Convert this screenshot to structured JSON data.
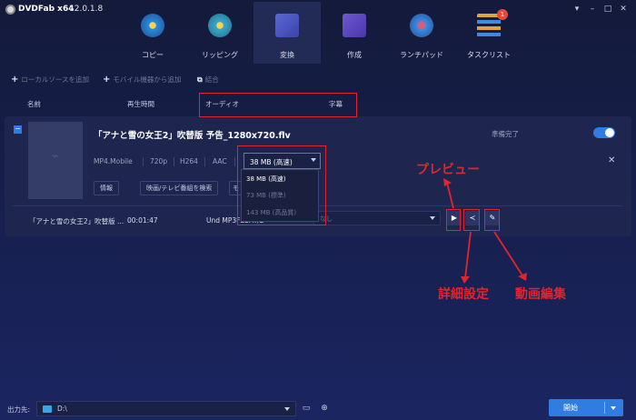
{
  "app": {
    "name": "DVDFab x64",
    "version": "12.0.1.8"
  },
  "tabs": [
    {
      "label": "コピー",
      "icon": "copy-disc-icon",
      "color": "#2a8bd8"
    },
    {
      "label": "リッピング",
      "icon": "ripper-disc-icon",
      "color": "#3aa7c9"
    },
    {
      "label": "変換",
      "icon": "film-convert-icon",
      "color": "#5b66d8"
    },
    {
      "label": "作成",
      "icon": "creator-icon",
      "color": "#6f58d4"
    },
    {
      "label": "ランチパッド",
      "icon": "rocket-icon",
      "color": "#3c8be0"
    },
    {
      "label": "タスクリスト",
      "icon": "task-list-icon",
      "color": "#e1a33b",
      "badge": "1"
    }
  ],
  "toolbar": {
    "add_local": "ローカルソースを追加",
    "add_mobile": "モバイル機器から追加",
    "merge": "結合"
  },
  "columns": {
    "name": "名前",
    "duration": "再生時間",
    "audio": "オーディオ",
    "subtitle": "字幕"
  },
  "item": {
    "title": "「アナと雪の女王2」吹替版 予告_1280x720.flv",
    "status": "準備完了",
    "meta": {
      "profile": "MP4.Mobile",
      "resolution": "720p",
      "codec": "H264",
      "audio": "AAC"
    },
    "size_selected": "38 MB (高速)",
    "buttons": {
      "info": "情報",
      "search": "映画/テレビ番組を検索",
      "more": "モ"
    },
    "row": {
      "name": "「アナと雪の女王2」吹替版 ...",
      "duration": "00:01:47",
      "audio_track": "Und  MP3FLOAT/2",
      "subtitle": "なし"
    }
  },
  "size_options": [
    {
      "label": "38 MB (高速)",
      "color": "#ffffff"
    },
    {
      "label": "73 MB (標準)",
      "color": "#6e7698"
    },
    {
      "label": "143 MB (高品質)",
      "color": "#6e7698"
    }
  ],
  "annotations": {
    "preview": "プレビュー",
    "settings": "詳細設定",
    "edit": "動画編集"
  },
  "output": {
    "label": "出力先:",
    "path": "D:\\"
  },
  "start_button": "開始",
  "colors": {
    "accent": "#2f7de1",
    "annotation": "#e0252f"
  }
}
